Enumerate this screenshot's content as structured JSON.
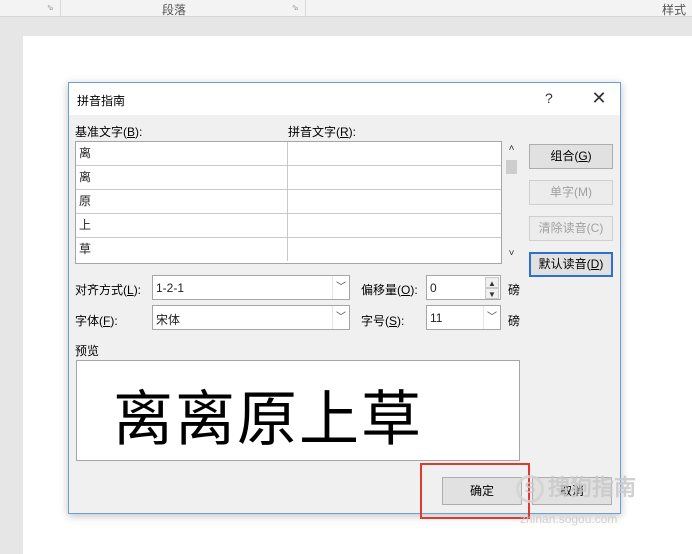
{
  "ribbon": {
    "group_paragraph": "段落",
    "group_styles": "样式"
  },
  "dialog": {
    "title": "拼音指南",
    "help_label": "?",
    "close_label": "✕",
    "base_text_label_pre": "基准文字(",
    "base_text_key": "B",
    "base_text_label_post": "):",
    "ruby_text_label_pre": "拼音文字(",
    "ruby_text_key": "R",
    "ruby_text_label_post": "):",
    "rows": [
      {
        "base": "离",
        "ruby": ""
      },
      {
        "base": "离",
        "ruby": ""
      },
      {
        "base": "原",
        "ruby": ""
      },
      {
        "base": "上",
        "ruby": ""
      },
      {
        "base": "草",
        "ruby": ""
      }
    ],
    "buttons": {
      "group_pre": "组合(",
      "group_key": "G",
      "group_post": ")",
      "mono": "单字(M)",
      "clear": "清除读音(C)",
      "default_pre": "默认读音(",
      "default_key": "D",
      "default_post": ")"
    },
    "alignment": {
      "label_pre": "对齐方式(",
      "key": "L",
      "label_post": "):",
      "value": "1-2-1"
    },
    "offset": {
      "label_pre": "偏移量(",
      "key": "O",
      "label_post": "):",
      "value": "0",
      "unit": "磅"
    },
    "font": {
      "label_pre": "字体(",
      "key": "F",
      "label_post": "):",
      "value": "宋体"
    },
    "size": {
      "label_pre": "字号(",
      "key": "S",
      "label_post": "):",
      "value": "11",
      "unit": "磅"
    },
    "preview_label": "预览",
    "preview_text": "离离原上草",
    "ok_label": "确定",
    "cancel_label": "取消"
  },
  "watermark": {
    "logo_glyph": "S",
    "text": "搜狗指南",
    "url": "zhinan.sogou.com"
  },
  "colors": {
    "highlight": "#e0392f",
    "dialog_border": "#6aa0d8",
    "focus": "#2f6fd0"
  }
}
